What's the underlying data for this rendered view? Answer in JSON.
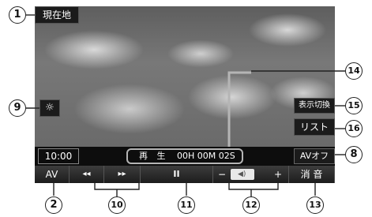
{
  "screen": {
    "current_location_label": "現在地",
    "display_switch_label": "表示切換",
    "list_label": "リスト",
    "brightness_icon": "sun-icon",
    "clock": "10:00",
    "play_status": "再 生",
    "play_time": "00H 00M 02S",
    "av_off_label": "AVオフ"
  },
  "bottom_bar": {
    "av_label": "AV",
    "rewind_icon": "◂◂",
    "forward_icon": "▸▸",
    "pause_icon": "II",
    "vol_minus": "−",
    "vol_plus": "+",
    "mute_label": "消 音"
  },
  "callouts": {
    "c1": "1",
    "c2": "2",
    "c8": "8",
    "c9": "9",
    "c10": "10",
    "c11": "11",
    "c12": "12",
    "c13": "13",
    "c14": "14",
    "c15": "15",
    "c16": "16"
  }
}
